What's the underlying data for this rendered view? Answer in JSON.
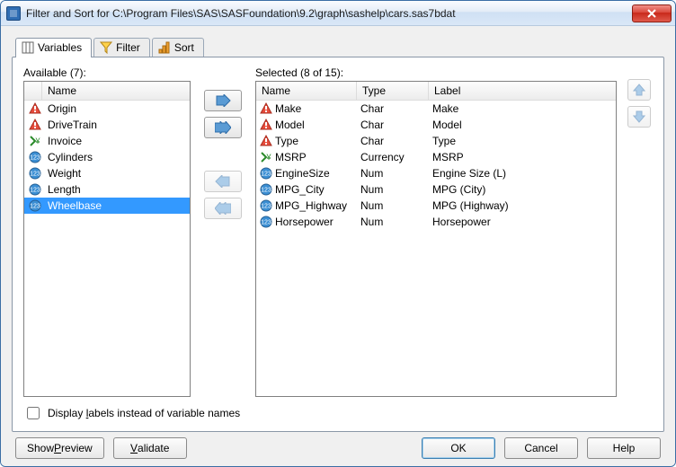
{
  "window": {
    "title": "Filter and Sort for C:\\Program Files\\SAS\\SASFoundation\\9.2\\graph\\sashelp\\cars.sas7bdat"
  },
  "tabs": [
    {
      "name": "Variables",
      "icon": "columns"
    },
    {
      "name": "Filter",
      "icon": "funnel"
    },
    {
      "name": "Sort",
      "icon": "bars"
    }
  ],
  "active_tab": 0,
  "available": {
    "label": "Available (7):",
    "header": "Name",
    "items": [
      {
        "name": "Origin",
        "icon": "tri"
      },
      {
        "name": "DriveTrain",
        "icon": "tri"
      },
      {
        "name": "Invoice",
        "icon": "curr"
      },
      {
        "name": "Cylinders",
        "icon": "num"
      },
      {
        "name": "Weight",
        "icon": "num"
      },
      {
        "name": "Length",
        "icon": "num"
      },
      {
        "name": "Wheelbase",
        "icon": "num",
        "selected": true
      }
    ]
  },
  "selected": {
    "label": "Selected (8 of 15):",
    "headers": {
      "name": "Name",
      "type": "Type",
      "label": "Label"
    },
    "items": [
      {
        "name": "Make",
        "type": "Char",
        "label": "Make",
        "icon": "tri"
      },
      {
        "name": "Model",
        "type": "Char",
        "label": "Model",
        "icon": "tri"
      },
      {
        "name": "Type",
        "type": "Char",
        "label": "Type",
        "icon": "tri"
      },
      {
        "name": "MSRP",
        "type": "Currency",
        "label": "MSRP",
        "icon": "curr"
      },
      {
        "name": "EngineSize",
        "type": "Num",
        "label": "Engine Size (L)",
        "icon": "num"
      },
      {
        "name": "MPG_City",
        "type": "Num",
        "label": "MPG (City)",
        "icon": "num"
      },
      {
        "name": "MPG_Highway",
        "type": "Num",
        "label": "MPG (Highway)",
        "icon": "num"
      },
      {
        "name": "Horsepower",
        "type": "Num",
        "label": "Horsepower",
        "icon": "num"
      }
    ]
  },
  "display_labels_instead": {
    "label": "Display labels instead of variable names",
    "checked": false
  },
  "buttons": {
    "show_preview": "Show Preview",
    "validate": "Validate",
    "ok": "OK",
    "cancel": "Cancel",
    "help": "Help"
  }
}
